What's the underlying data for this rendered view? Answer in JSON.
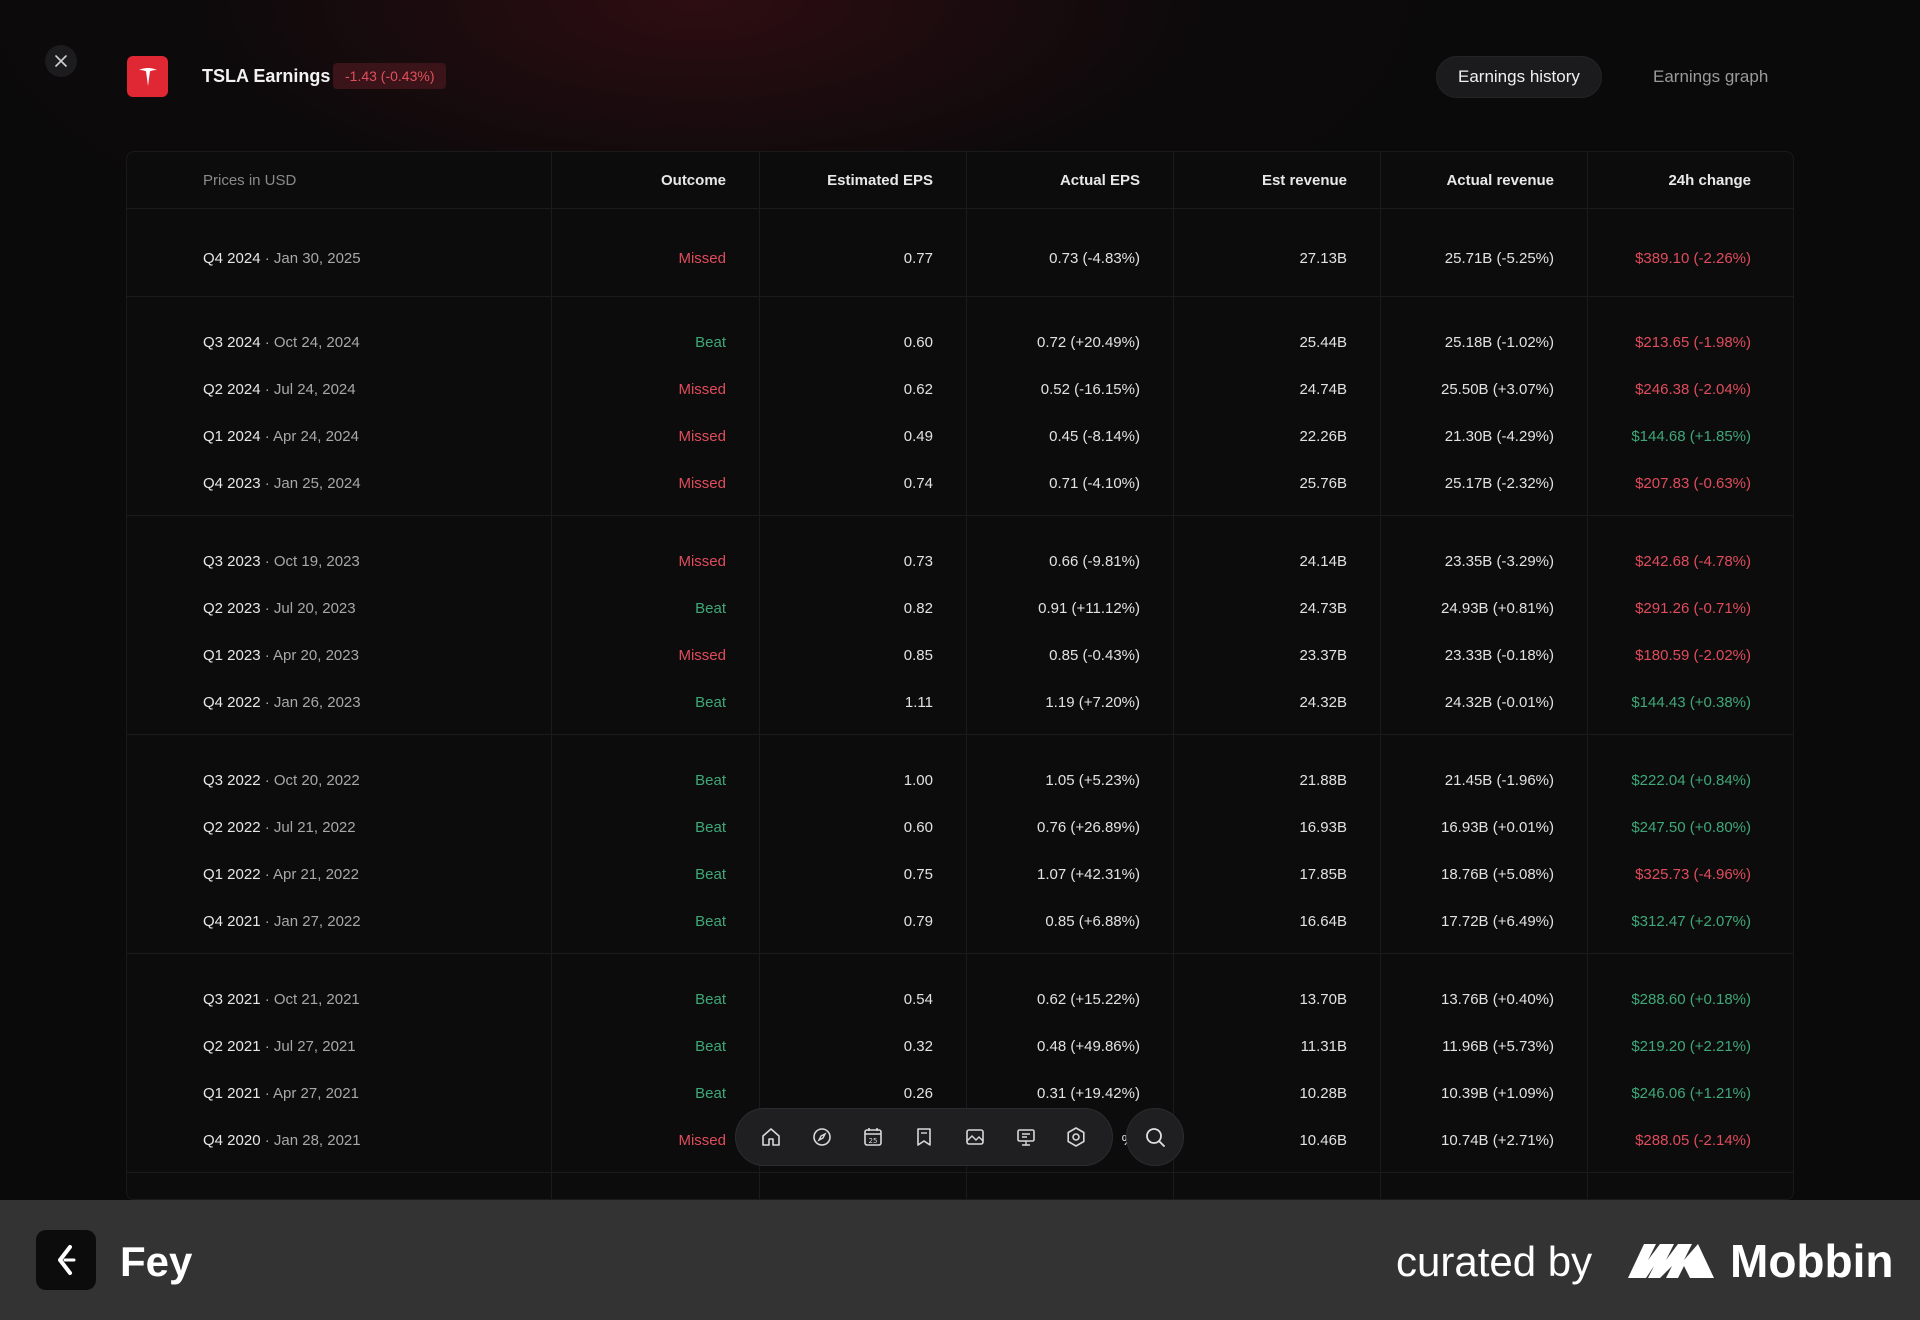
{
  "header": {
    "title": "TSLA Earnings",
    "change_badge": "-1.43 (-0.43%)",
    "tabs": [
      {
        "label": "Earnings history",
        "active": true
      },
      {
        "label": "Earnings graph",
        "active": false
      }
    ]
  },
  "table": {
    "columns": [
      "Prices in USD",
      "Outcome",
      "Estimated EPS",
      "Actual EPS",
      "Est revenue",
      "Actual revenue",
      "24h change"
    ],
    "rows": [
      {
        "quarter": "Q4 2024",
        "date": " · Jan 30, 2025",
        "outcome": "Missed",
        "est_eps": "0.77",
        "actual_eps": "0.73 (-4.83%)",
        "est_rev": "27.13B",
        "actual_rev": "25.71B (-5.25%)",
        "change": "$389.10 (-2.26%)",
        "change_dir": "neg"
      },
      {
        "quarter": "Q3 2024",
        "date": " · Oct 24, 2024",
        "outcome": "Beat",
        "est_eps": "0.60",
        "actual_eps": "0.72 (+20.49%)",
        "est_rev": "25.44B",
        "actual_rev": "25.18B (-1.02%)",
        "change": "$213.65 (-1.98%)",
        "change_dir": "neg"
      },
      {
        "quarter": "Q2 2024",
        "date": " · Jul 24, 2024",
        "outcome": "Missed",
        "est_eps": "0.62",
        "actual_eps": "0.52 (-16.15%)",
        "est_rev": "24.74B",
        "actual_rev": "25.50B (+3.07%)",
        "change": "$246.38 (-2.04%)",
        "change_dir": "neg"
      },
      {
        "quarter": "Q1 2024",
        "date": " · Apr 24, 2024",
        "outcome": "Missed",
        "est_eps": "0.49",
        "actual_eps": "0.45 (-8.14%)",
        "est_rev": "22.26B",
        "actual_rev": "21.30B (-4.29%)",
        "change": "$144.68 (+1.85%)",
        "change_dir": "pos"
      },
      {
        "quarter": "Q4 2023",
        "date": " · Jan 25, 2024",
        "outcome": "Missed",
        "est_eps": "0.74",
        "actual_eps": "0.71 (-4.10%)",
        "est_rev": "25.76B",
        "actual_rev": "25.17B (-2.32%)",
        "change": "$207.83 (-0.63%)",
        "change_dir": "neg"
      },
      {
        "quarter": "Q3 2023",
        "date": " · Oct 19, 2023",
        "outcome": "Missed",
        "est_eps": "0.73",
        "actual_eps": "0.66 (-9.81%)",
        "est_rev": "24.14B",
        "actual_rev": "23.35B (-3.29%)",
        "change": "$242.68 (-4.78%)",
        "change_dir": "neg"
      },
      {
        "quarter": "Q2 2023",
        "date": " · Jul 20, 2023",
        "outcome": "Beat",
        "est_eps": "0.82",
        "actual_eps": "0.91 (+11.12%)",
        "est_rev": "24.73B",
        "actual_rev": "24.93B (+0.81%)",
        "change": "$291.26 (-0.71%)",
        "change_dir": "neg"
      },
      {
        "quarter": "Q1 2023",
        "date": " · Apr 20, 2023",
        "outcome": "Missed",
        "est_eps": "0.85",
        "actual_eps": "0.85 (-0.43%)",
        "est_rev": "23.37B",
        "actual_rev": "23.33B (-0.18%)",
        "change": "$180.59 (-2.02%)",
        "change_dir": "neg"
      },
      {
        "quarter": "Q4 2022",
        "date": " · Jan 26, 2023",
        "outcome": "Beat",
        "est_eps": "1.11",
        "actual_eps": "1.19 (+7.20%)",
        "est_rev": "24.32B",
        "actual_rev": "24.32B (-0.01%)",
        "change": "$144.43 (+0.38%)",
        "change_dir": "pos"
      },
      {
        "quarter": "Q3 2022",
        "date": " · Oct 20, 2022",
        "outcome": "Beat",
        "est_eps": "1.00",
        "actual_eps": "1.05 (+5.23%)",
        "est_rev": "21.88B",
        "actual_rev": "21.45B (-1.96%)",
        "change": "$222.04 (+0.84%)",
        "change_dir": "pos"
      },
      {
        "quarter": "Q2 2022",
        "date": " · Jul 21, 2022",
        "outcome": "Beat",
        "est_eps": "0.60",
        "actual_eps": "0.76 (+26.89%)",
        "est_rev": "16.93B",
        "actual_rev": "16.93B (+0.01%)",
        "change": "$247.50 (+0.80%)",
        "change_dir": "pos"
      },
      {
        "quarter": "Q1 2022",
        "date": " · Apr 21, 2022",
        "outcome": "Beat",
        "est_eps": "0.75",
        "actual_eps": "1.07 (+42.31%)",
        "est_rev": "17.85B",
        "actual_rev": "18.76B (+5.08%)",
        "change": "$325.73 (-4.96%)",
        "change_dir": "neg"
      },
      {
        "quarter": "Q4 2021",
        "date": " · Jan 27, 2022",
        "outcome": "Beat",
        "est_eps": "0.79",
        "actual_eps": "0.85 (+6.88%)",
        "est_rev": "16.64B",
        "actual_rev": "17.72B (+6.49%)",
        "change": "$312.47 (+2.07%)",
        "change_dir": "pos"
      },
      {
        "quarter": "Q3 2021",
        "date": " · Oct 21, 2021",
        "outcome": "Beat",
        "est_eps": "0.54",
        "actual_eps": "0.62 (+15.22%)",
        "est_rev": "13.70B",
        "actual_rev": "13.76B (+0.40%)",
        "change": "$288.60 (+0.18%)",
        "change_dir": "pos"
      },
      {
        "quarter": "Q2 2021",
        "date": " · Jul 27, 2021",
        "outcome": "Beat",
        "est_eps": "0.32",
        "actual_eps": "0.48 (+49.86%)",
        "est_rev": "11.31B",
        "actual_rev": "11.96B (+5.73%)",
        "change": "$219.20 (+2.21%)",
        "change_dir": "pos"
      },
      {
        "quarter": "Q1 2021",
        "date": " · Apr 27, 2021",
        "outcome": "Beat",
        "est_eps": "0.26",
        "actual_eps": "0.31 (+19.42%)",
        "est_rev": "10.28B",
        "actual_rev": "10.39B (+1.09%)",
        "change": "$246.06 (+1.21%)",
        "change_dir": "pos"
      },
      {
        "quarter": "Q4 2020",
        "date": " · Jan 28, 2021",
        "outcome": "Missed",
        "est_eps": "",
        "actual_eps": "%)",
        "est_rev": "10.46B",
        "actual_rev": "10.74B (+2.71%)",
        "change": "$288.05 (-2.14%)",
        "change_dir": "neg"
      }
    ]
  },
  "dock": {
    "icons": [
      "home-icon",
      "compass-icon",
      "calendar-icon",
      "bookmark-icon",
      "image-icon",
      "presentation-icon",
      "settings-icon"
    ],
    "calendar_day": "25",
    "search_icon": "search-icon"
  },
  "footer": {
    "app_name": "Fey",
    "curated_by": "curated by",
    "brand": "Mobbin"
  },
  "colors": {
    "beat": "#3fa878",
    "missed": "#e04c5c",
    "logo_red": "#e02834"
  }
}
